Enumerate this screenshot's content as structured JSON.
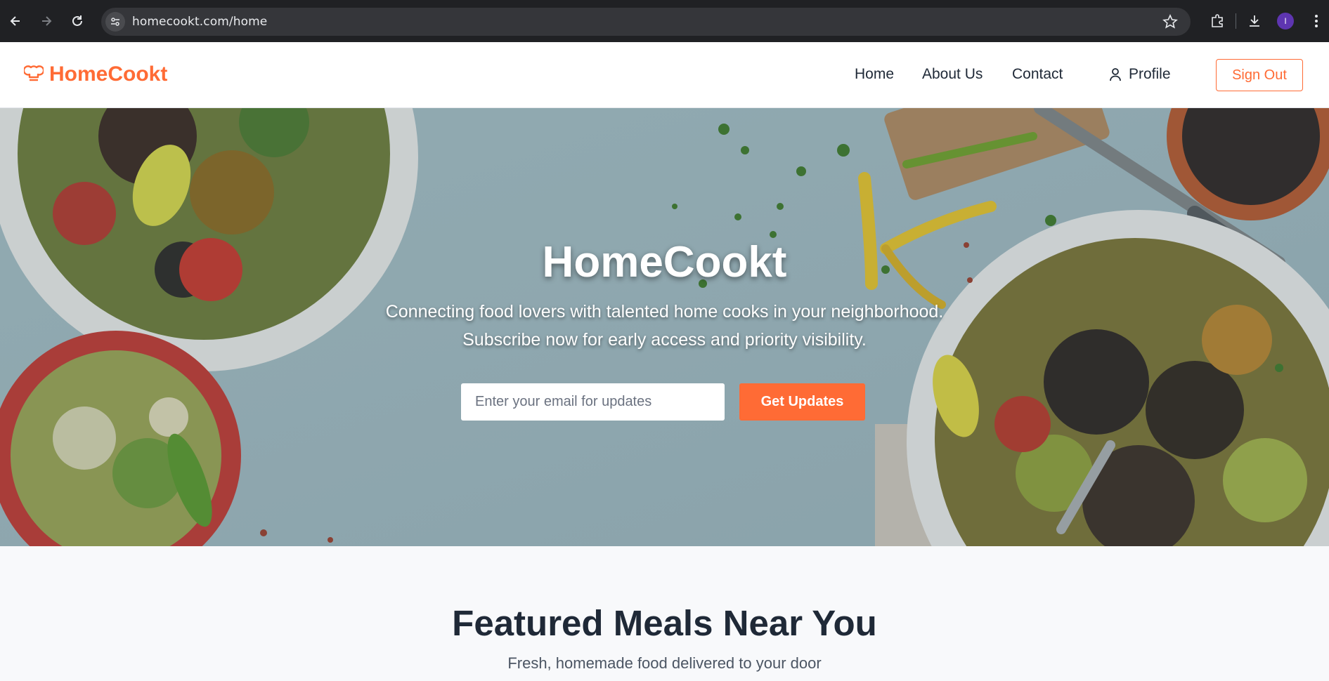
{
  "browser": {
    "url": "homecookt.com/home",
    "profile_initial": "I"
  },
  "header": {
    "brand": "HomeCookt",
    "nav": [
      "Home",
      "About Us",
      "Contact"
    ],
    "profile_label": "Profile",
    "signout_label": "Sign Out",
    "accent_color": "#ff6b35"
  },
  "hero": {
    "title": "HomeCookt",
    "subtitle_line1": "Connecting food lovers with talented home cooks in your neighborhood.",
    "subtitle_line2": "Subscribe now for early access and priority visibility.",
    "email_placeholder": "Enter your email for updates",
    "cta_label": "Get Updates"
  },
  "featured": {
    "title": "Featured Meals Near You",
    "subtitle": "Fresh, homemade food delivered to your door"
  }
}
